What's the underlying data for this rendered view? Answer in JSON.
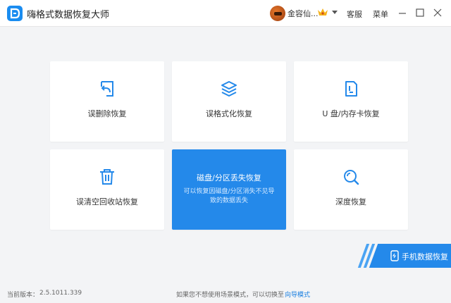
{
  "app": {
    "title": "嗨格式数据恢复大师"
  },
  "header": {
    "username": "金容仙...",
    "menu_service": "客服",
    "menu_main": "菜单"
  },
  "cards": [
    {
      "label": "误删除恢复"
    },
    {
      "label": "误格式化恢复"
    },
    {
      "label": "U 盘/内存卡恢复"
    },
    {
      "label": "误清空回收站恢复"
    },
    {
      "label": "磁盘/分区丢失恢复",
      "desc": "可以恢复因磁盘/分区消失不见导致的数据丢失"
    },
    {
      "label": "深度恢复"
    }
  ],
  "mobile_recovery": {
    "label": "手机数据恢复"
  },
  "footer": {
    "version_label": "当前版本：",
    "version": "2.5.1011.339",
    "hint": "如果您不想使用场景模式，可以切换至",
    "guide_link": "向导模式"
  },
  "colors": {
    "accent": "#2489ea",
    "background": "#f3f4f6",
    "card": "#ffffff"
  }
}
